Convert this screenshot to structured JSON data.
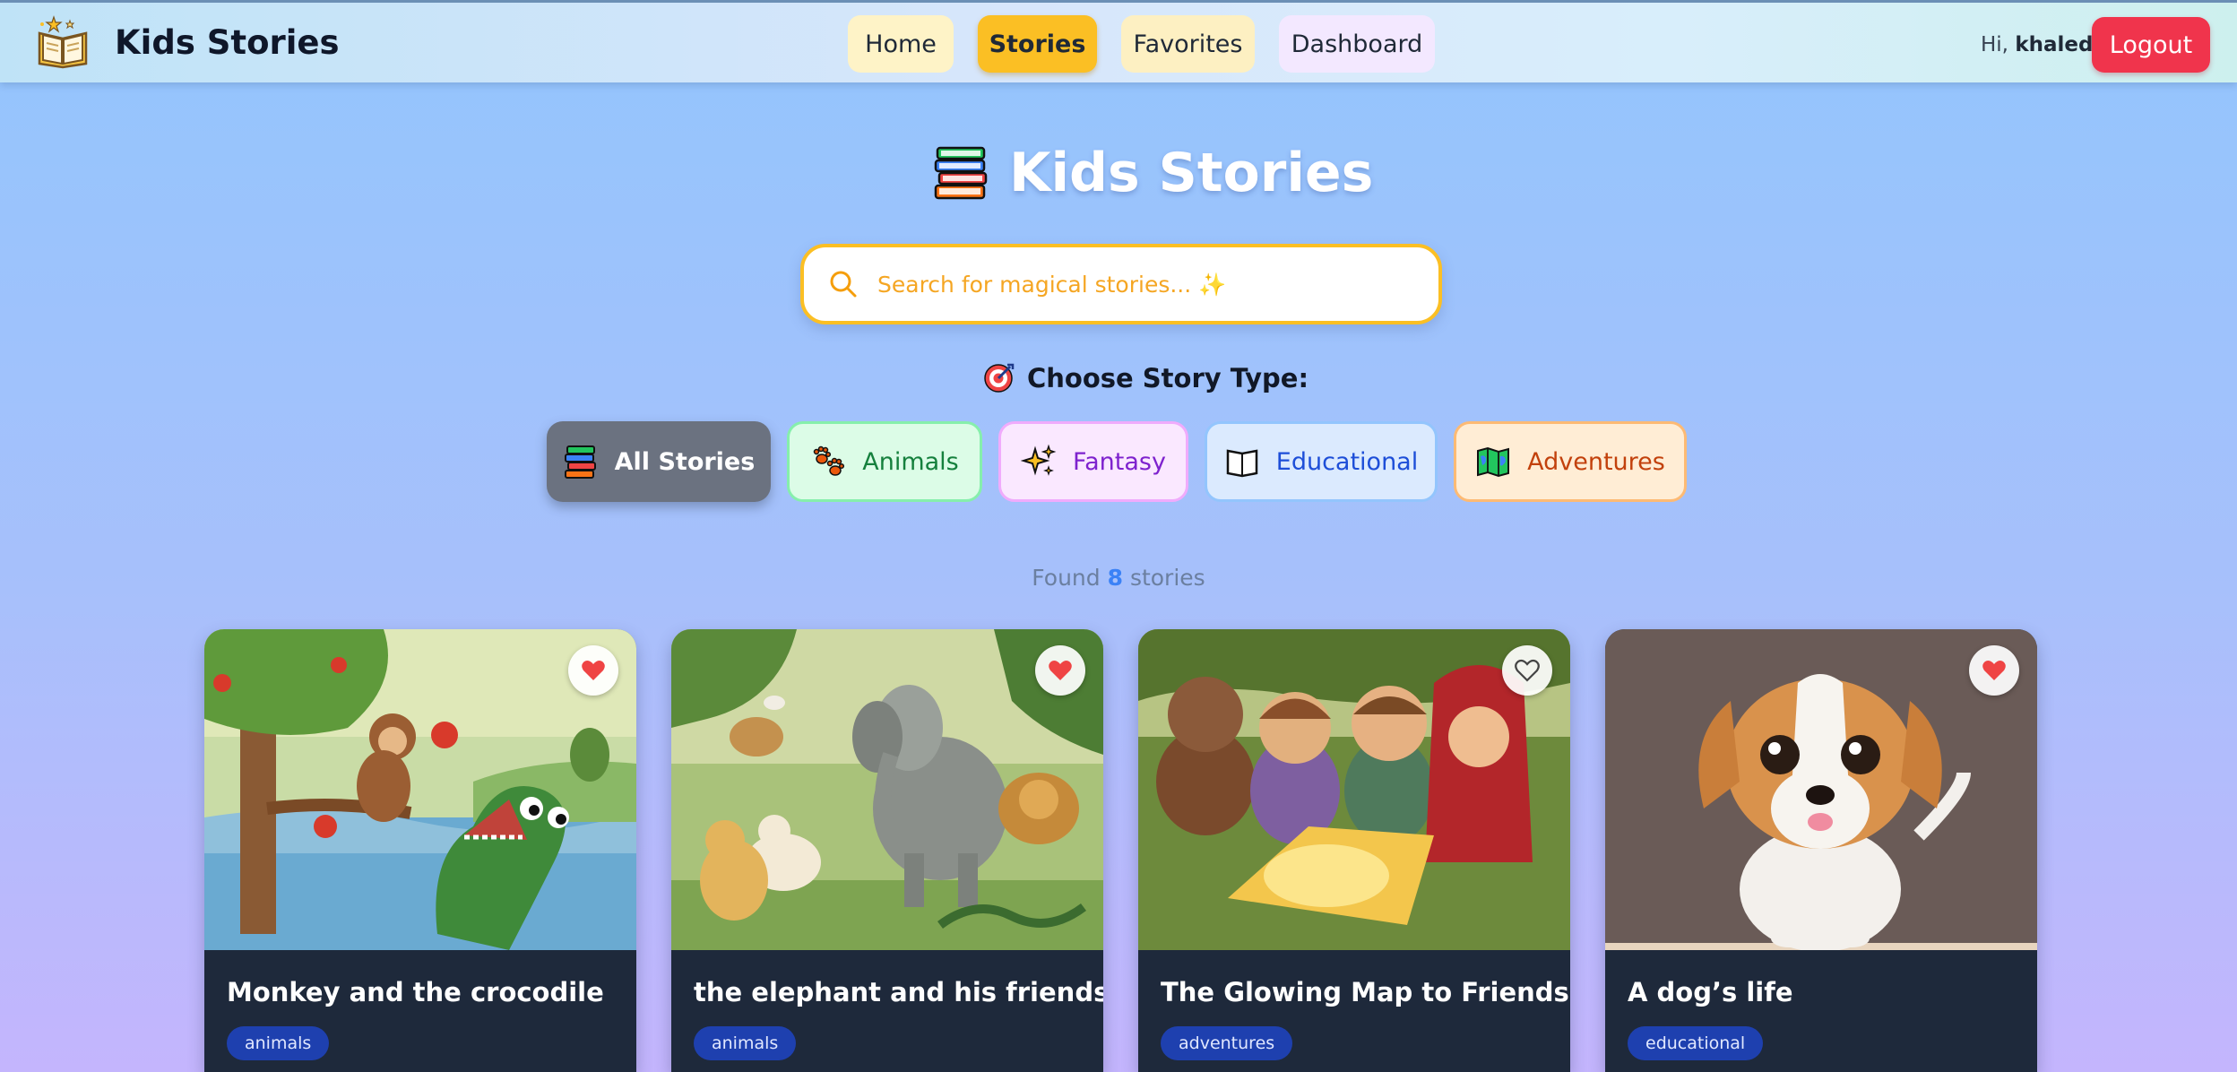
{
  "navbar": {
    "brand_name": "Kids Stories",
    "links": [
      {
        "label": "Home"
      },
      {
        "label": "Stories"
      },
      {
        "label": "Favorites"
      },
      {
        "label": "Dashboard"
      }
    ],
    "active_link": "Stories",
    "greeting_prefix": "Hi,",
    "username": "khaled",
    "logout_label": "Logout"
  },
  "hero": {
    "title": "Kids Stories",
    "icon": "books-icon"
  },
  "search": {
    "placeholder": "Search for magical stories... ✨",
    "value": ""
  },
  "filters": {
    "label": "Choose Story Type:",
    "items": [
      {
        "label": "All Stories",
        "icon": "books-icon",
        "active": true
      },
      {
        "label": "Animals",
        "icon": "paw-icon",
        "active": false
      },
      {
        "label": "Fantasy",
        "icon": "sparkles-icon",
        "active": false
      },
      {
        "label": "Educational",
        "icon": "book-icon",
        "active": false
      },
      {
        "label": "Adventures",
        "icon": "map-icon",
        "active": false
      }
    ]
  },
  "results": {
    "prefix": "Found",
    "count": "8",
    "suffix": "stories"
  },
  "stories": [
    {
      "title": "Monkey and the crocodile",
      "tag": "animals",
      "favorited": true,
      "image": "monkey-crocodile-illustration"
    },
    {
      "title": "the elephant and his friends",
      "tag": "animals",
      "favorited": true,
      "image": "elephant-friends-illustration"
    },
    {
      "title": "The Glowing Map to Friendship",
      "tag": "adventures",
      "favorited": false,
      "image": "children-map-illustration"
    },
    {
      "title": "A dog’s life",
      "tag": "educational",
      "favorited": true,
      "image": "puppy-illustration"
    }
  ],
  "colors": {
    "accent": "#fbbf24",
    "logout": "#f0344c",
    "tag_bg": "#1e40af",
    "card_bg": "#1e293b",
    "heart": "#ef4444"
  }
}
